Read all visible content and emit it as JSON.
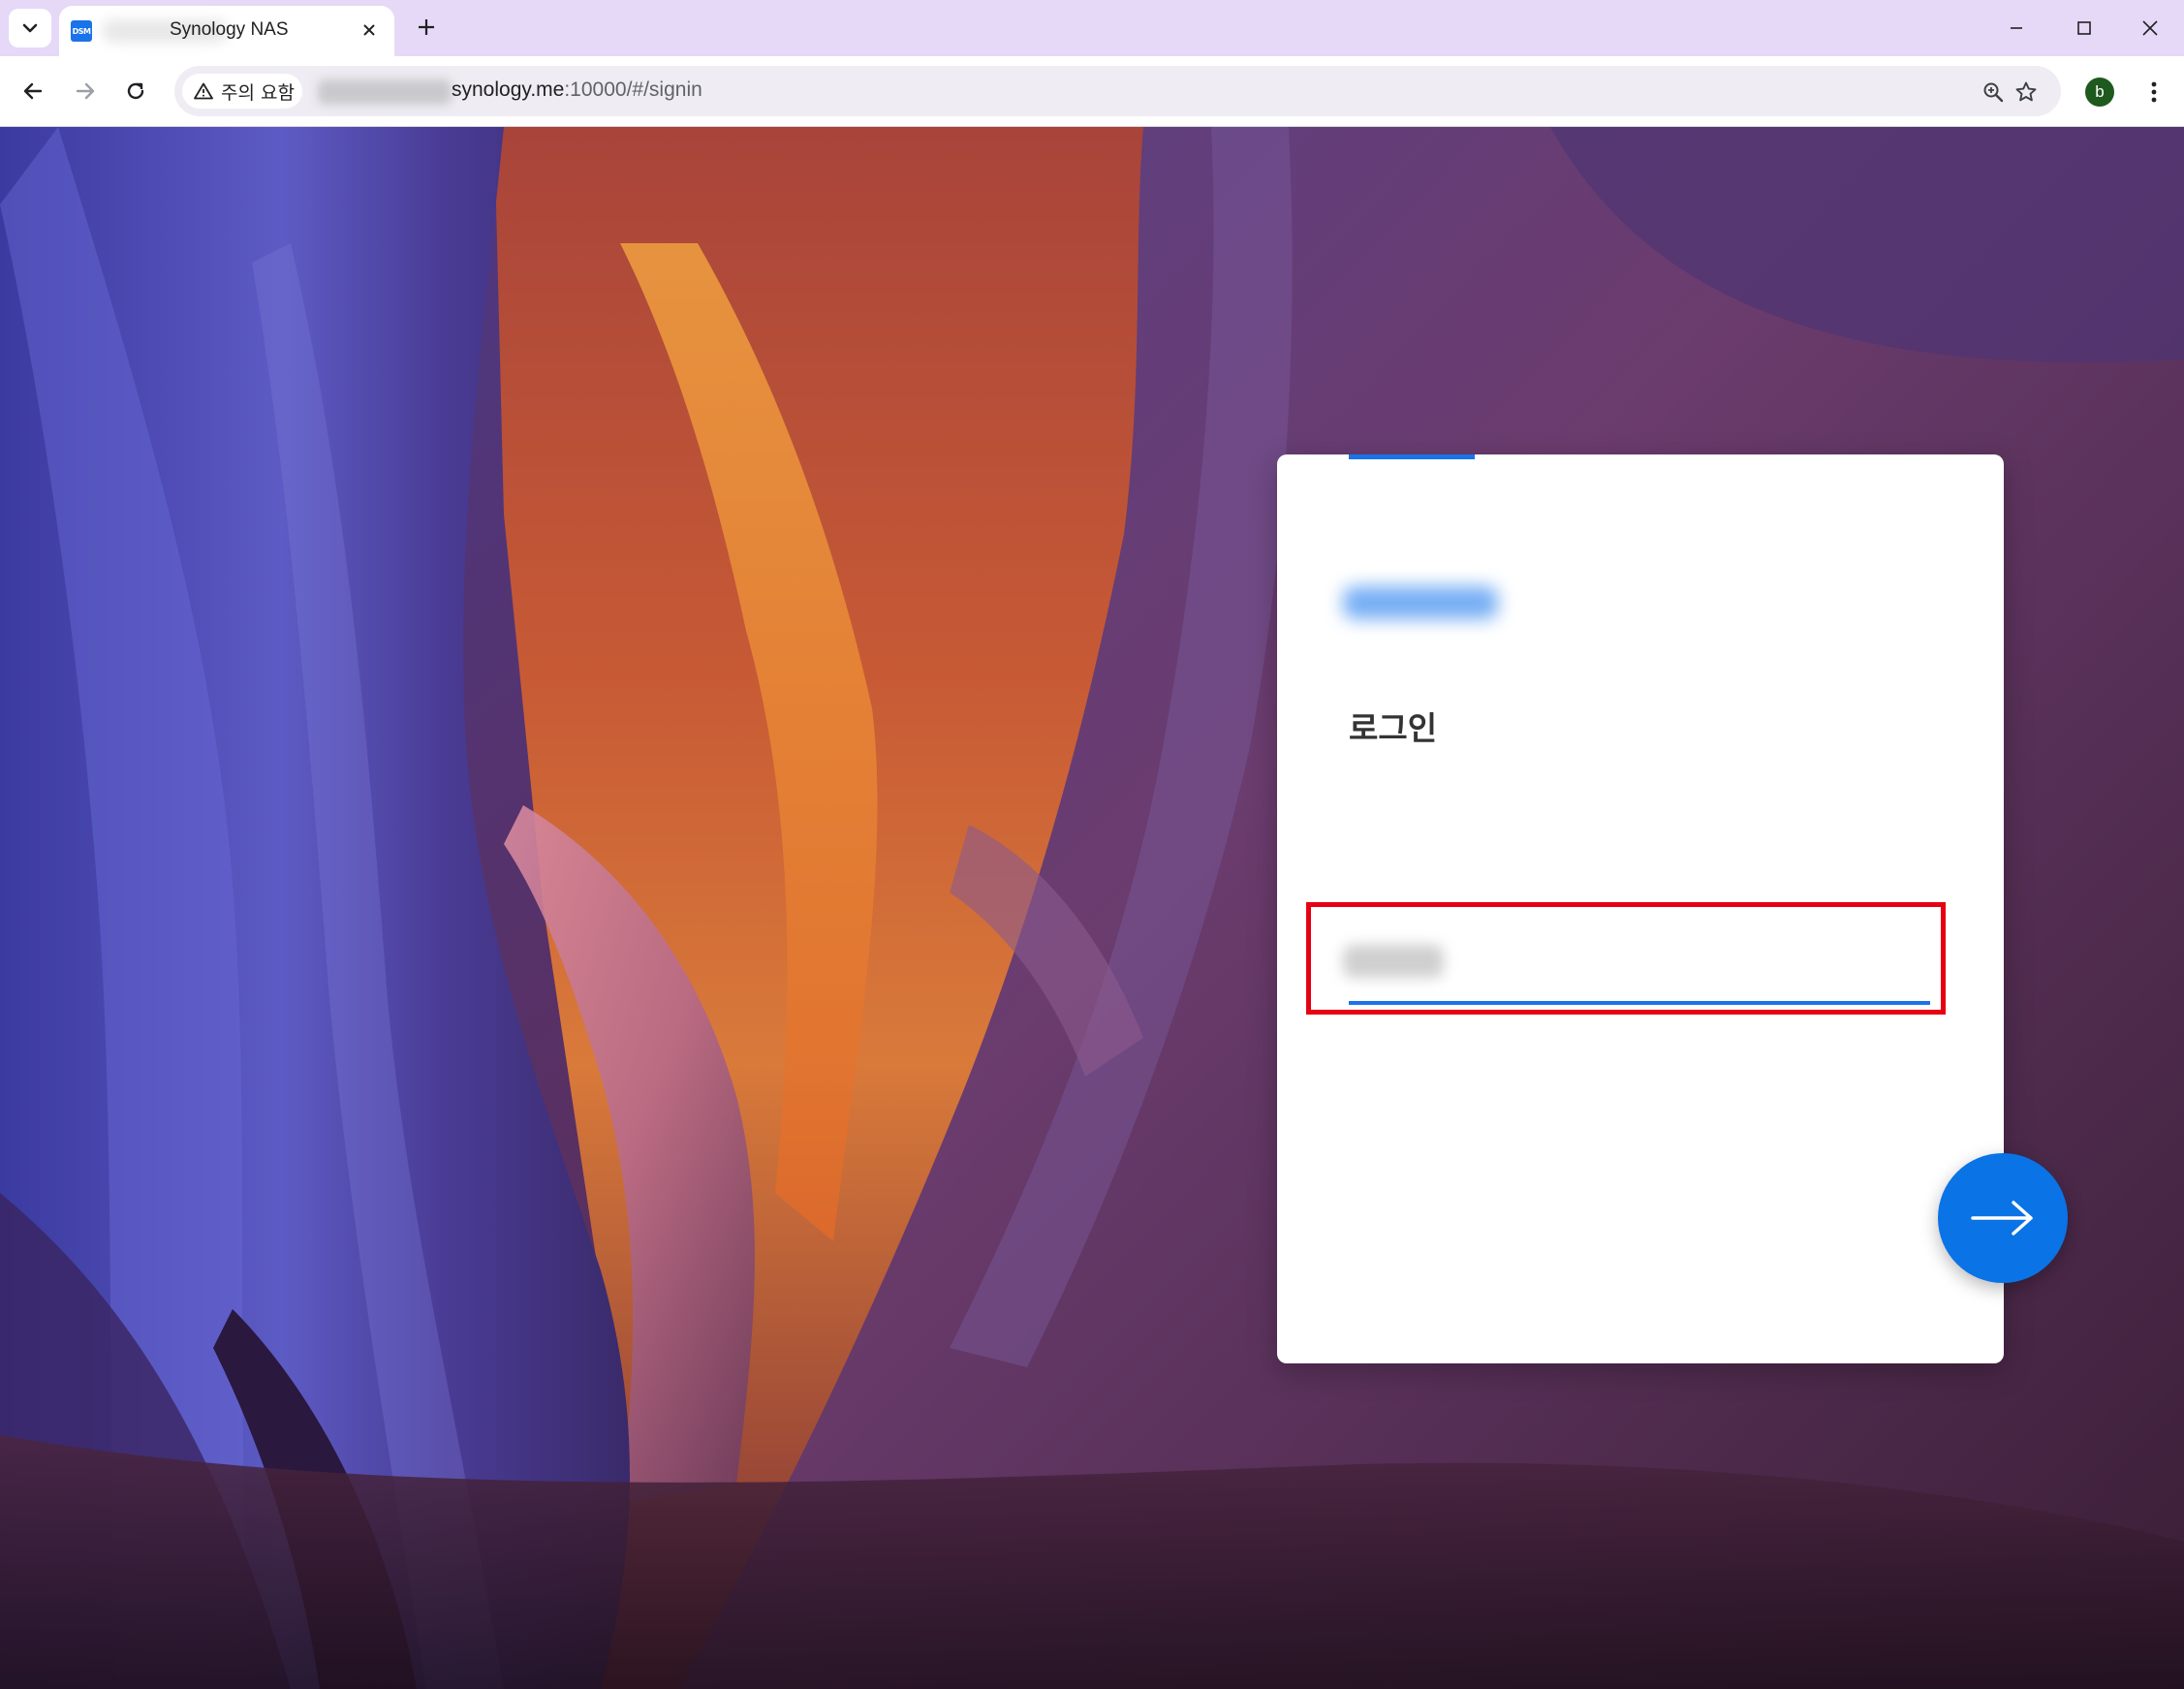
{
  "browser": {
    "tab_title": "Synology NAS",
    "tab_favicon_text": "DSM",
    "security_chip": "주의 요함",
    "url_host": "synology.me",
    "url_path": ":10000/#/signin",
    "profile_initial": "b",
    "icons": {
      "tab_menu": "chevron-down-icon",
      "tab_close": "close-icon",
      "new_tab": "plus-icon",
      "minimize": "minimize-icon",
      "maximize": "maximize-icon",
      "close_window": "close-icon",
      "back": "arrow-left-icon",
      "forward": "arrow-right-icon",
      "reload": "reload-icon",
      "warning": "warning-triangle-icon",
      "zoom": "zoom-icon",
      "bookmark": "star-icon",
      "menu": "kebab-menu-icon"
    }
  },
  "login": {
    "title": "로그인",
    "next_button_icon": "arrow-right-icon",
    "highlight_color": "#e60012",
    "accent_color": "#1a73e8"
  }
}
